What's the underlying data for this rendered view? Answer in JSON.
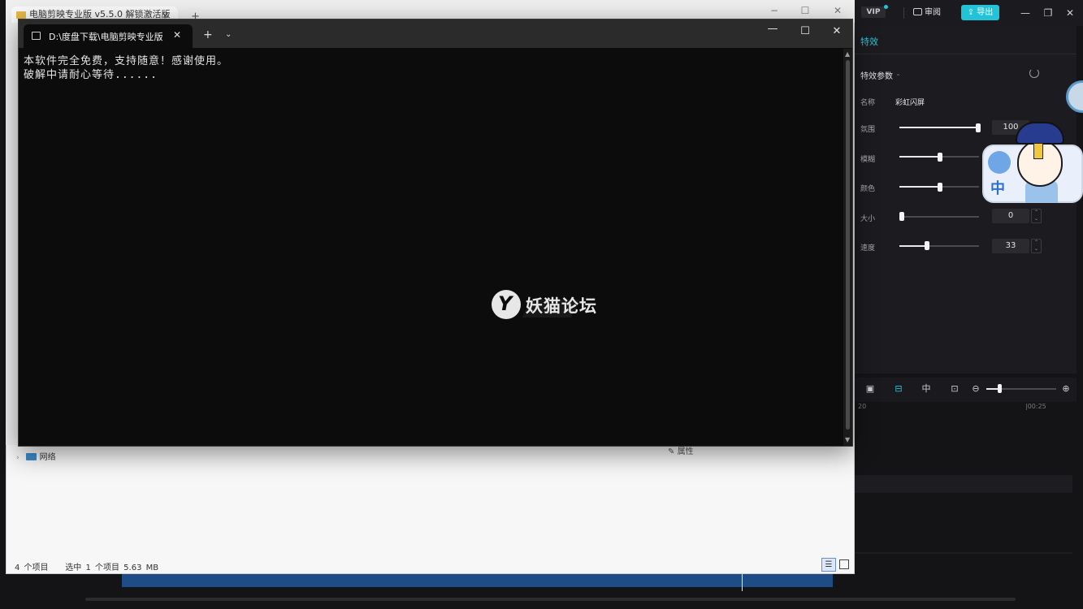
{
  "explorer": {
    "tab_title": "电脑剪映专业版 v5.5.0 解锁激活版",
    "add_tab": "+",
    "win_min": "−",
    "win_max": "☐",
    "win_close": "✕",
    "nav_network": "网络",
    "properties": "属性",
    "status_items": "4 个项目",
    "status_selected": "选中 1 个项目  5.63 MB"
  },
  "terminal": {
    "tab_title": "D:\\度盘下载\\电脑剪映专业版 v",
    "close": "✕",
    "new_tab": "+",
    "dropdown": "⌄",
    "min": "—",
    "max": "☐",
    "win_close": "✕",
    "lines": [
      "本软件完全免费，支持随意！感谢使用。",
      "破解中请耐心等待......"
    ]
  },
  "watermark": {
    "text": "妖猫论坛"
  },
  "editor": {
    "vip": "VIP",
    "review": "审阅",
    "export": "导出",
    "panel_tab": "特效",
    "params_title": "特效参数",
    "name_label": "名称",
    "name_value": "彩虹闪屏",
    "params": [
      {
        "label": "氛围",
        "value": "100",
        "level": 1.0
      },
      {
        "label": "模糊",
        "value": "",
        "level": 0.5
      },
      {
        "label": "颜色",
        "value": "",
        "level": 0.5
      },
      {
        "label": "大小",
        "value": "0",
        "level": 0.0
      },
      {
        "label": "速度",
        "value": "33",
        "level": 0.33
      }
    ],
    "timeline_ticks": [
      "20",
      "|00:25"
    ],
    "toolbar_icons": [
      "color-tool-icon",
      "link-icon",
      "center-icon",
      "preview-icon",
      "zoom-out-icon",
      "zoom-in-icon"
    ]
  },
  "sticker": {
    "text": "中"
  },
  "colors": {
    "accent": "#22c3d6",
    "terminal_bg": "#0c0c0c",
    "explorer_bg": "#f7f7f7",
    "editor_bg": "#141417",
    "clip_blue": "#1d4c86"
  }
}
